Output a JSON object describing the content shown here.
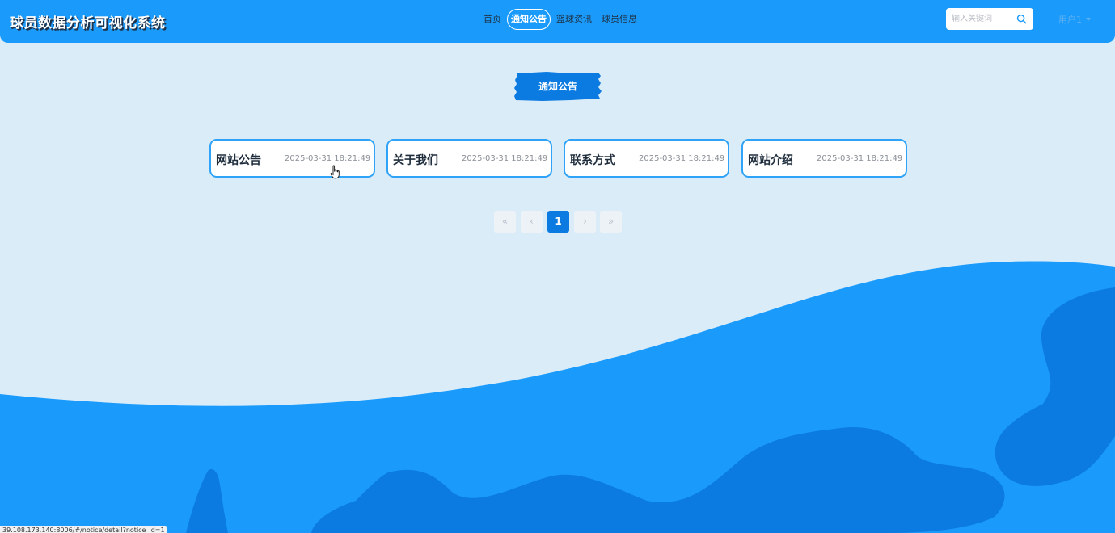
{
  "app": {
    "title": "球员数据分析可视化系统"
  },
  "nav": {
    "items": [
      {
        "label": "首页"
      },
      {
        "label": "通知公告"
      },
      {
        "label": "篮球资讯"
      },
      {
        "label": "球员信息"
      }
    ],
    "active_index": 1
  },
  "search": {
    "placeholder": "输入关键词"
  },
  "user": {
    "name": "用户1"
  },
  "section": {
    "title": "通知公告"
  },
  "notices": [
    {
      "title": "网站公告",
      "date": "2025-03-31 18:21:49"
    },
    {
      "title": "关于我们",
      "date": "2025-03-31 18:21:49"
    },
    {
      "title": "联系方式",
      "date": "2025-03-31 18:21:49"
    },
    {
      "title": "网站介绍",
      "date": "2025-03-31 18:21:49"
    }
  ],
  "pagination": {
    "first": "«",
    "prev": "‹",
    "current": "1",
    "next": "›",
    "last": "»"
  },
  "status_bar": {
    "url": "39.108.173.140:8006/#/notice/detail?notice_id=1"
  },
  "colors": {
    "header": "#1a9bfc",
    "page_bg": "#dbecf9",
    "wave_light": "#1a9bfc",
    "wave_dark": "#0c7be1",
    "accent": "#0c7be1"
  }
}
